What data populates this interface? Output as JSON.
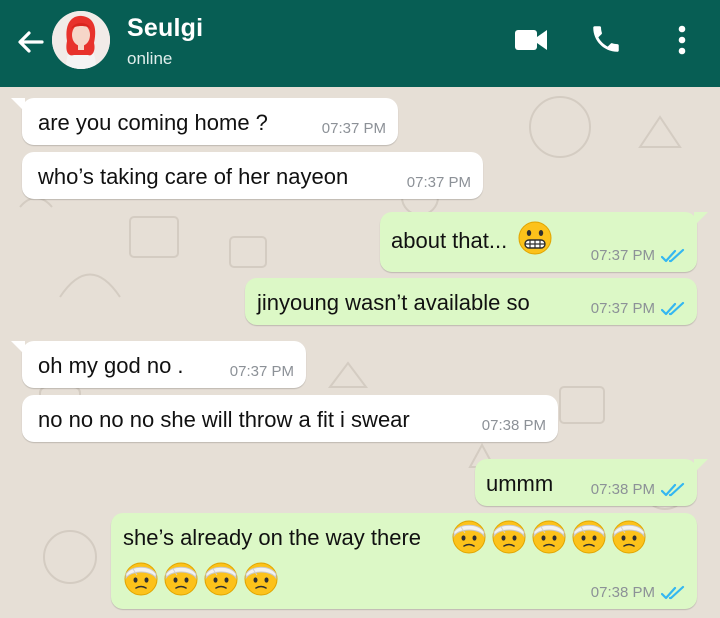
{
  "header": {
    "contact_name": "Seulgi",
    "status": "online",
    "icons": [
      "back-arrow-icon",
      "video-call-icon",
      "phone-icon",
      "more-vert-icon"
    ],
    "color": "#075e54"
  },
  "colors": {
    "incoming_bubble": "#ffffff",
    "outgoing_bubble": "#dcf8c6",
    "read_ticks": "#34b7f1",
    "wallpaper": "#e6dfd6"
  },
  "messages": [
    {
      "direction": "in",
      "text": "are you coming home ?",
      "time": "07:37 PM"
    },
    {
      "direction": "in",
      "text": "who’s taking care of her nayeon",
      "time": "07:37 PM"
    },
    {
      "direction": "out",
      "text": "about that...",
      "emoji": "grimacing-face",
      "time": "07:37 PM",
      "read": true
    },
    {
      "direction": "out",
      "text": "jinyoung wasn’t available so",
      "time": "07:37 PM",
      "read": true
    },
    {
      "direction": "in",
      "text": "oh my god no .",
      "time": "07:37 PM"
    },
    {
      "direction": "in",
      "text": "no no no no she will throw a fit i swear",
      "time": "07:38 PM"
    },
    {
      "direction": "out",
      "text": "ummm",
      "time": "07:38 PM",
      "read": true
    },
    {
      "direction": "out",
      "text": "she’s already on the way there",
      "emoji": "face-with-head-bandage",
      "emoji_count": 9,
      "time": "07:38 PM",
      "read": true
    }
  ]
}
